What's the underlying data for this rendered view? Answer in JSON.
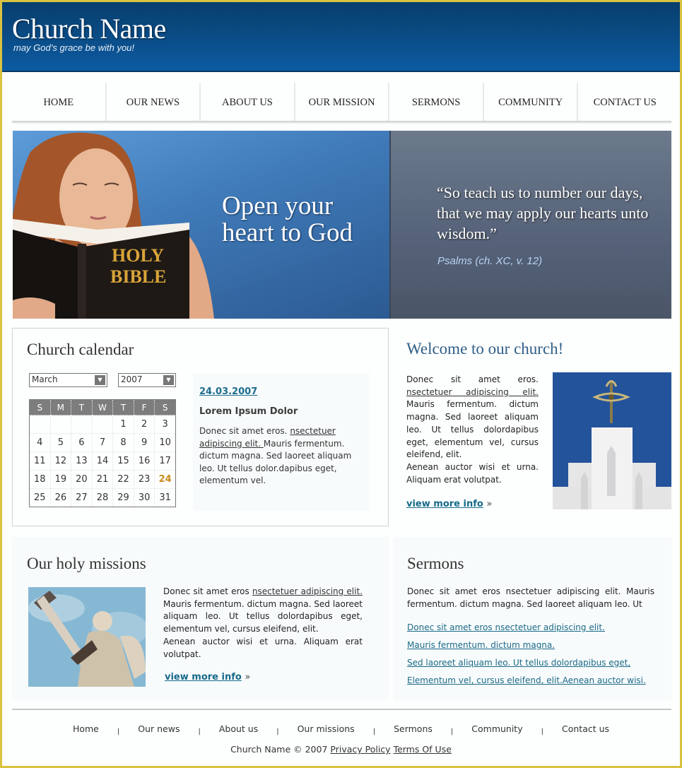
{
  "header": {
    "title": "Church Name",
    "tagline": "may God’s grace be with you!"
  },
  "nav": {
    "items": [
      {
        "label": "HOME"
      },
      {
        "label": "OUR NEWS"
      },
      {
        "label": "ABOUT US"
      },
      {
        "label": "OUR MISSION"
      },
      {
        "label": "SERMONS"
      },
      {
        "label": "COMMUNITY"
      },
      {
        "label": "CONTACT US"
      }
    ]
  },
  "hero": {
    "headline_line1": "Open your",
    "headline_line2": "heart to God",
    "book_title_line1": "HOLY",
    "book_title_line2": "BIBLE",
    "quote": "“So teach us to number our days, that we may apply our hearts unto wisdom.”",
    "quote_source": "Psalms (ch. XC, v. 12)"
  },
  "calendar": {
    "heading": "Church calendar",
    "month_selected": "March",
    "year_selected": "2007",
    "weekdays": [
      "S",
      "M",
      "T",
      "W",
      "T",
      "F",
      "S"
    ],
    "weeks": [
      [
        "",
        "",
        "",
        "",
        "1",
        "2",
        "3"
      ],
      [
        "4",
        "5",
        "6",
        "7",
        "8",
        "9",
        "10"
      ],
      [
        "11",
        "12",
        "13",
        "14",
        "15",
        "16",
        "17"
      ],
      [
        "18",
        "19",
        "20",
        "21",
        "22",
        "23",
        "24"
      ],
      [
        "25",
        "26",
        "27",
        "28",
        "29",
        "30",
        "31"
      ]
    ],
    "highlighted_day": "24",
    "highlight_color": "#c98d1f",
    "event": {
      "date": "24.03.2007",
      "title": "Lorem Ipsum Dolor",
      "body_pre": "Donec sit amet eros. ",
      "body_link": "nsectetuer adipiscing elit. ",
      "body_post": "Mauris fermentum. dictum magna. Sed laoreet aliquam leo. Ut tellus dolor.dapibus eget, elementum vel."
    }
  },
  "welcome": {
    "heading": "Welcome to our church!",
    "body_pre": "Donec sit amet eros. ",
    "body_link": "nsectetuer adipiscing elit.",
    "body_post": " Mauris fermentum. dictum magna. Sed laoreet aliquam leo. Ut tellus dolordapibus eget, elementum vel, cursus eleifend, elit.",
    "body_para2": "Aenean auctor wisi et urna. Aliquam erat volutpat.",
    "more_label": "view more info",
    "more_arrow": "»"
  },
  "missions": {
    "heading": "Our holy missions",
    "body_pre": "Donec sit amet eros ",
    "body_link": "nsectetuer adipiscing elit.",
    "body_post": " Mauris fermentum. dictum magna. Sed laoreet aliquam leo. Ut tellus dolordapibus eget, elementum vel, cursus eleifend, elit.",
    "body_para2": "Aenean auctor wisi et urna. Aliquam erat volutpat.",
    "more_label": "view more info",
    "more_arrow": "»"
  },
  "sermons": {
    "heading": "Sermons",
    "body": "Donec sit amet eros nsectetuer adipiscing elit. Mauris fermentum. dictum magna. Sed laoreet aliquam leo. Ut",
    "links": [
      "Donec sit amet eros nsectetuer adipiscing elit.",
      "Mauris fermentum. dictum magna.",
      "Sed laoreet aliquam leo. Ut tellus dolordapibus eget,",
      "Elementum vel, cursus eleifend, elit.Aenean auctor wisi."
    ]
  },
  "footer": {
    "links": [
      "Home",
      "Our news",
      "About us",
      "Our missions",
      "Sermons",
      "Community",
      "Contact us"
    ],
    "separator": "|",
    "copyright": "Church Name © 2007",
    "privacy": "Privacy Policy",
    "terms": "Terms Of Use"
  },
  "colors": {
    "header_blue": "#0a4a83",
    "link_teal": "#156a8a",
    "frame_gold": "#d9c23f"
  }
}
